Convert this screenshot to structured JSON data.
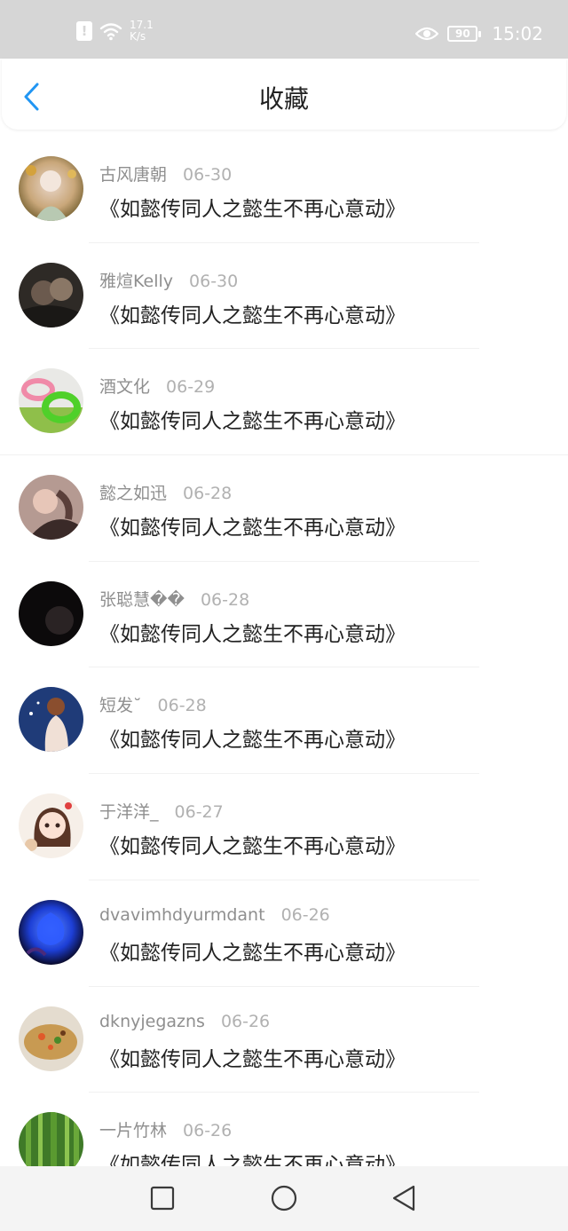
{
  "status_bar": {
    "net_speed_value": "17.1",
    "net_speed_unit": "K/s",
    "battery": "90",
    "time": "15:02"
  },
  "header": {
    "title": "收藏"
  },
  "items": [
    {
      "user": "古风唐朝",
      "date": "06-30",
      "title": "《如懿传同人之懿生不再心意动》"
    },
    {
      "user": "雅煊Kelly",
      "date": "06-30",
      "title": "《如懿传同人之懿生不再心意动》"
    },
    {
      "user": "酒文化",
      "date": "06-29",
      "title": "《如懿传同人之懿生不再心意动》"
    },
    {
      "user": "懿之如迅",
      "date": "06-28",
      "title": "《如懿传同人之懿生不再心意动》"
    },
    {
      "user": "张聪慧��",
      "date": "06-28",
      "title": "《如懿传同人之懿生不再心意动》"
    },
    {
      "user": "短发˘",
      "date": "06-28",
      "title": "《如懿传同人之懿生不再心意动》"
    },
    {
      "user": "于洋洋_",
      "date": "06-27",
      "title": "《如懿传同人之懿生不再心意动》"
    },
    {
      "user": "dvavimhdyurmdant",
      "date": "06-26",
      "title": "《如懿传同人之懿生不再心意动》"
    },
    {
      "user": "dknyjegazns",
      "date": "06-26",
      "title": "《如懿传同人之懿生不再心意动》"
    },
    {
      "user": "一片竹林",
      "date": "06-26",
      "title": "《如懿传同人之懿生不再心意动》"
    }
  ],
  "colors": {
    "accent": "#2196f3",
    "status_bar_bg": "#d6d6d6",
    "username": "#8f8f8f",
    "date": "#b1b1b1",
    "title_text": "#222222"
  },
  "icons": {
    "back": "chevron-left-icon",
    "nav_recent": "square-icon",
    "nav_home": "circle-icon",
    "nav_back": "triangle-left-icon"
  }
}
